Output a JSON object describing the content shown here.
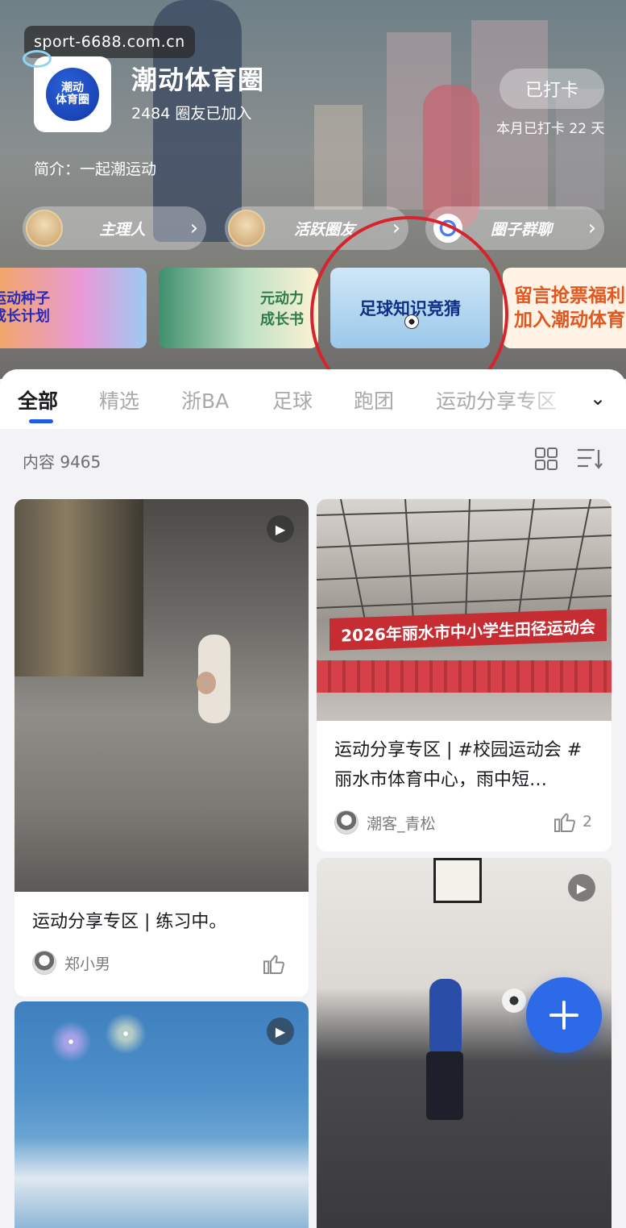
{
  "watermark": "sport-6688.com.cn",
  "circle": {
    "logo_text": "潮动\n体育圈",
    "name": "潮动体育圈",
    "members": "2484 圈友已加入",
    "intro": "简介：一起潮运动",
    "checkin_label": "已打卡",
    "checkin_days": "本月已打卡 22 天"
  },
  "pills": [
    {
      "label": "主理人"
    },
    {
      "label": "活跃圈友"
    },
    {
      "label": "圈子群聊"
    }
  ],
  "banners": [
    {
      "text": "运动种子\n成长计划"
    },
    {
      "text": "元动力\n成长书"
    },
    {
      "text": "足球知识竞猜"
    },
    {
      "text": "留言抢票福利\n加入潮动体育"
    }
  ],
  "tabs": [
    "全部",
    "精选",
    "浙BA",
    "足球",
    "跑团",
    "运动分享专区"
  ],
  "content_count": "内容 9465",
  "posts": [
    {
      "text": "运动分享专区 | 练习中。",
      "author": "郑小男",
      "likes": ""
    },
    {
      "text": "运动分享专区 | #校园运动会 # 丽水市体育中心，雨中短…",
      "author": "潮客_青松",
      "likes": "2",
      "image_caption": "2026年丽水市中小学生田径运动会"
    },
    {
      "text": "",
      "author": "",
      "likes": ""
    },
    {
      "text": "",
      "author": "",
      "likes": ""
    }
  ],
  "colors": {
    "accent": "#1f5ce6",
    "annotation": "#d7232a",
    "fab": "#2d6ae8"
  },
  "icons": {
    "grid": "grid-view-icon",
    "sort": "sort-icon",
    "play": "play-icon",
    "like": "thumbs-up-icon",
    "add": "plus-icon",
    "chevron": "chevron-right-icon"
  }
}
